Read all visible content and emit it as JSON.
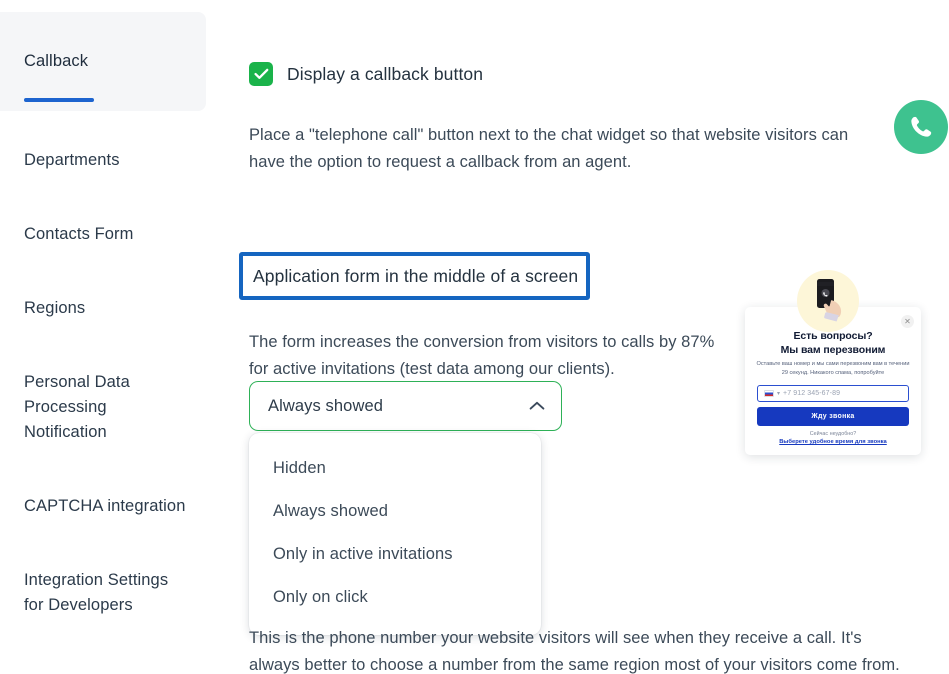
{
  "sidebar": {
    "items": [
      {
        "label": "Callback",
        "active": true
      },
      {
        "label": "Departments",
        "active": false
      },
      {
        "label": "Contacts Form",
        "active": false
      },
      {
        "label": "Regions",
        "active": false
      },
      {
        "label": "Personal Data\nProcessing\nNotification",
        "active": false
      },
      {
        "label": "CAPTCHA integration",
        "active": false
      },
      {
        "label": "Integration Settings\nfor Developers",
        "active": false
      }
    ]
  },
  "main": {
    "callback_checkbox": {
      "label": "Display a callback button",
      "checked": true,
      "check_color": "#1ab34a"
    },
    "callback_description": "Place a \"telephone call\" button next to the chat widget so that website visitors can have the option to request a callback from an agent.",
    "form_heading": "Application form in the middle of a screen",
    "form_heading_highlight_color": "#1565c0",
    "form_description": "The form increases the conversion from visitors to calls by 87% for active invitations (test data among our clients).",
    "phone_description": "This is the phone number your website visitors will see when they receive a call. It's always better to choose a number from the same region most of your visitors come from.",
    "form_select": {
      "value": "Always showed",
      "expanded": true,
      "border_color": "#2eb157",
      "chevron": "chevron-up-icon",
      "options": [
        "Hidden",
        "Always showed",
        "Only in active invitations",
        "Only on click"
      ]
    },
    "callback_fab": {
      "icon": "phone-icon",
      "color": "#3ec28f"
    }
  },
  "widget_preview": {
    "close_label": "✕",
    "title_line1": "Есть вопросы?",
    "title_line2": "Мы вам перезвоним",
    "subtext": "Оставьте ваш номер и мы сами перезвоним вам в течении 29 секунд. Никакого спама, попробуйте",
    "phone_value": "+7 912 345-67-89",
    "button_label": "Жду звонка",
    "footer_text": "Сейчас неудобно?",
    "footer_link": "Выберете удобное время для звонка",
    "button_color": "#1639bf"
  }
}
